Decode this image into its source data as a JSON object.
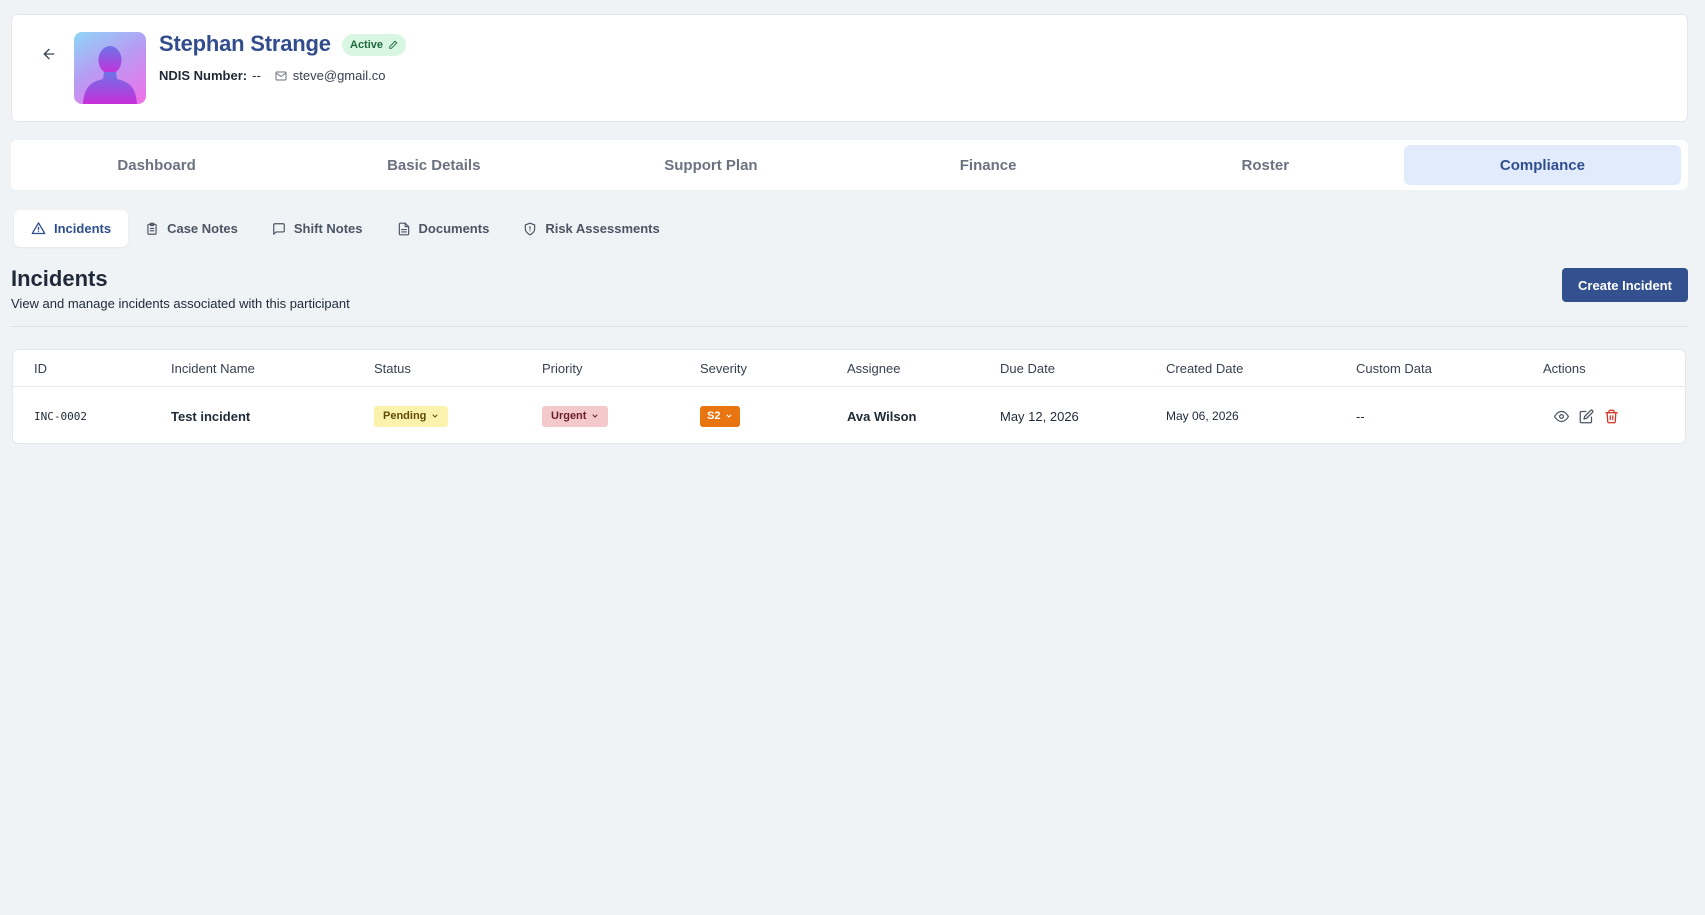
{
  "profile": {
    "name": "Stephan Strange",
    "status": "Active",
    "ndis_label": "NDIS Number:",
    "ndis_value": "--",
    "email": "steve@gmail.co"
  },
  "main_tabs": [
    {
      "label": "Dashboard",
      "active": false
    },
    {
      "label": "Basic Details",
      "active": false
    },
    {
      "label": "Support Plan",
      "active": false
    },
    {
      "label": "Finance",
      "active": false
    },
    {
      "label": "Roster",
      "active": false
    },
    {
      "label": "Compliance",
      "active": true
    }
  ],
  "sub_tabs": [
    {
      "label": "Incidents",
      "icon": "warning-triangle-icon",
      "active": true
    },
    {
      "label": "Case Notes",
      "icon": "clipboard-icon",
      "active": false
    },
    {
      "label": "Shift Notes",
      "icon": "message-square-icon",
      "active": false
    },
    {
      "label": "Documents",
      "icon": "file-text-icon",
      "active": false
    },
    {
      "label": "Risk Assessments",
      "icon": "shield-icon",
      "active": false
    }
  ],
  "section": {
    "title": "Incidents",
    "subtitle": "View and manage incidents associated with this participant",
    "create_label": "Create Incident"
  },
  "table": {
    "columns": [
      "ID",
      "Incident Name",
      "Status",
      "Priority",
      "Severity",
      "Assignee",
      "Due Date",
      "Created Date",
      "Custom Data",
      "Actions"
    ],
    "rows": [
      {
        "id": "INC-0002",
        "name": "Test incident",
        "status": "Pending",
        "priority": "Urgent",
        "severity": "S2",
        "assignee": "Ava Wilson",
        "due_date": "May 12, 2026",
        "created_date": "May 06, 2026",
        "custom_data": "--"
      }
    ]
  },
  "colors": {
    "brand": "#33508f",
    "active_tab_bg": "#e2ebfb",
    "status_active_bg": "#d9f6e2",
    "pending_bg": "#fbf3ad",
    "urgent_bg": "#f3c9cc",
    "severity_bg": "#e8750f",
    "delete_icon": "#d92d20"
  }
}
